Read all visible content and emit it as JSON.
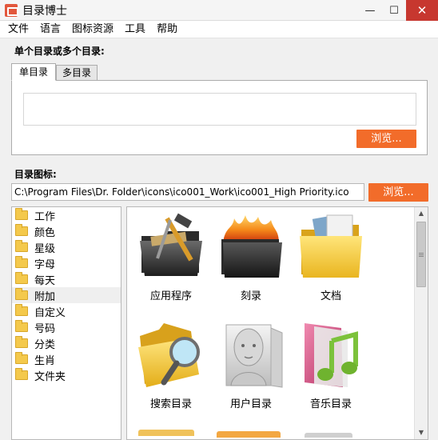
{
  "window": {
    "title": "目录博士"
  },
  "controls": {
    "minimize": "—",
    "maximize": "☐",
    "close": "✕"
  },
  "menu": [
    "文件",
    "语言",
    "图标资源",
    "工具",
    "帮助"
  ],
  "single_multi_label": "单个目录或多个目录:",
  "tabs": [
    "单目录",
    "多目录"
  ],
  "dir_input": {
    "value": ""
  },
  "browse_label": "浏览...",
  "icon_label": "目录图标:",
  "icon_path": "C:\\Program Files\\Dr. Folder\\icons\\ico001_Work\\ico001_High Priority.ico",
  "categories": [
    "工作",
    "颜色",
    "星级",
    "字母",
    "每天",
    "附加",
    "自定义",
    "号码",
    "分类",
    "生肖",
    "文件夹"
  ],
  "selected_category": "附加",
  "icons": [
    {
      "label": "应用程序",
      "icon": "apps-folder-icon"
    },
    {
      "label": "刻录",
      "icon": "burn-folder-icon"
    },
    {
      "label": "文档",
      "icon": "documents-folder-icon"
    },
    {
      "label": "搜索目录",
      "icon": "search-folder-icon"
    },
    {
      "label": "用户目录",
      "icon": "user-folder-icon"
    },
    {
      "label": "音乐目录",
      "icon": "music-folder-icon"
    }
  ]
}
